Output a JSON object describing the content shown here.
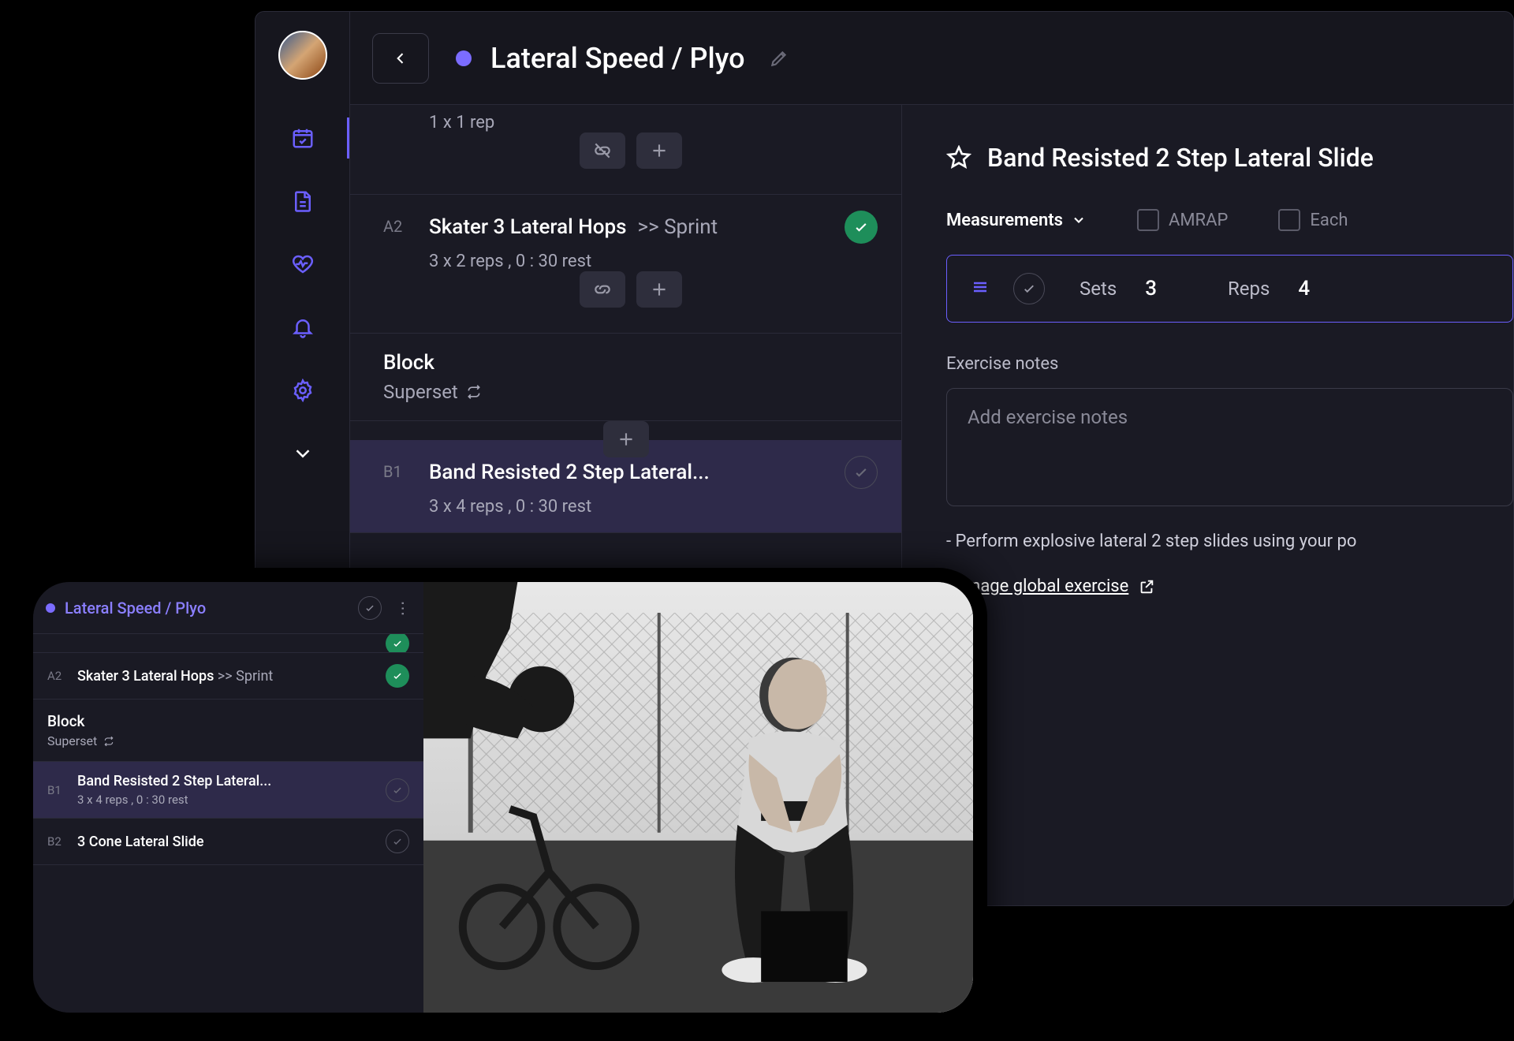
{
  "header": {
    "title": "Lateral Speed / Plyo"
  },
  "desktop_list": {
    "partial_meta": "1 x 1 rep",
    "items": [
      {
        "tag": "A2",
        "name": "Skater 3 Lateral Hops",
        "suffix": ">> Sprint",
        "meta": "3 x 2 reps ,  0 : 30 rest",
        "status": "done"
      },
      {
        "tag": "B1",
        "name": "Band Resisted 2 Step Lateral...",
        "meta": "3 x 4 reps ,  0 : 30 rest",
        "status": "pending",
        "selected": true
      }
    ],
    "block": {
      "label": "Block",
      "sub": "Superset"
    }
  },
  "detail": {
    "title": "Band Resisted 2 Step Lateral Slide",
    "measurements_label": "Measurements",
    "opt_amrap": "AMRAP",
    "opt_each": "Each",
    "sets_label": "Sets",
    "sets_value": "3",
    "reps_label": "Reps",
    "reps_value": "4",
    "notes_label": "Exercise notes",
    "notes_placeholder": "Add exercise notes",
    "description": "- Perform explosive lateral 2 step slides using your po",
    "manage_link": "Manage global exercise"
  },
  "mobile": {
    "title": "Lateral Speed / Plyo",
    "items": [
      {
        "tag": "A2",
        "name": "Skater 3 Lateral Hops",
        "suffix": ">> Sprint",
        "status": "done"
      },
      {
        "tag": "B1",
        "name": "Band Resisted 2 Step Lateral...",
        "meta": "3 x 4 reps ,  0 : 30 rest",
        "status": "pending",
        "selected": true
      },
      {
        "tag": "B2",
        "name": "3 Cone Lateral Slide",
        "status": "pending"
      }
    ],
    "block": {
      "label": "Block",
      "sub": "Superset"
    }
  }
}
